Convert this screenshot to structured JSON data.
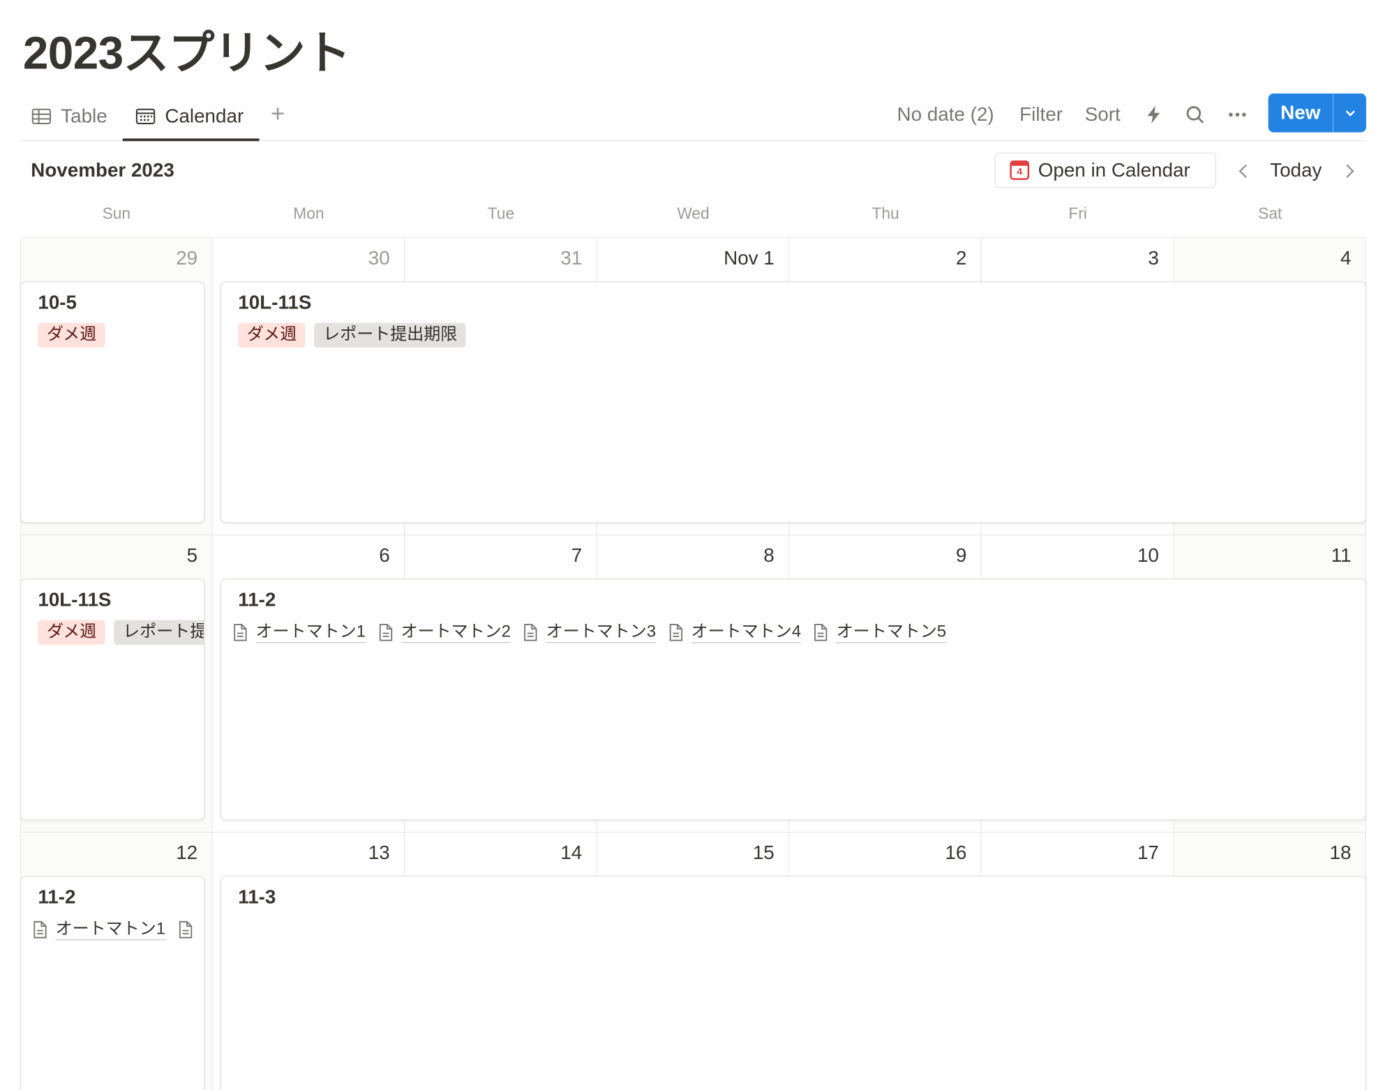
{
  "page": {
    "title": "2023スプリント"
  },
  "views": {
    "tabs": [
      {
        "label": "Table",
        "active": false
      },
      {
        "label": "Calendar",
        "active": true
      }
    ],
    "add": "+"
  },
  "toolbar": {
    "no_date": "No date (2)",
    "filter": "Filter",
    "sort": "Sort",
    "new_label": "New",
    "accent": "#2383e2"
  },
  "calendar": {
    "month_label": "November 2023",
    "open_in_calendar": "Open in Calendar",
    "open_icon_day": "4",
    "today": "Today",
    "weekdays": [
      "Sun",
      "Mon",
      "Tue",
      "Wed",
      "Thu",
      "Fri",
      "Sat"
    ],
    "weeks": [
      {
        "days": [
          "29",
          "30",
          "31",
          "Nov 1",
          "2",
          "3",
          "4"
        ],
        "cards": [
          {
            "title": "10-5",
            "tags": [
              {
                "label": "ダメ週",
                "color": "red"
              }
            ]
          },
          {
            "title": "10L-11S",
            "tags": [
              {
                "label": "ダメ週",
                "color": "red"
              },
              {
                "label": "レポート提出期限",
                "color": "gray"
              }
            ]
          }
        ]
      },
      {
        "days": [
          "5",
          "6",
          "7",
          "8",
          "9",
          "10",
          "11"
        ],
        "cards": [
          {
            "title": "10L-11S",
            "tags": [
              {
                "label": "ダメ週",
                "color": "red"
              },
              {
                "label": "レポート提",
                "color": "gray"
              }
            ]
          },
          {
            "title": "11-2",
            "relations": [
              "オートマトン1",
              "オートマトン2",
              "オートマトン3",
              "オートマトン4",
              "オートマトン5"
            ]
          }
        ]
      },
      {
        "days": [
          "12",
          "13",
          "14",
          "15",
          "16",
          "17",
          "18"
        ],
        "cards": [
          {
            "title": "11-2",
            "relations": [
              "オートマトン1",
              ""
            ]
          },
          {
            "title": "11-3"
          }
        ]
      }
    ]
  },
  "colors": {
    "tag_red_bg": "#ffe2dd",
    "tag_gray_bg": "#e3e2e0",
    "calendar_icon": "#e03e3e"
  }
}
